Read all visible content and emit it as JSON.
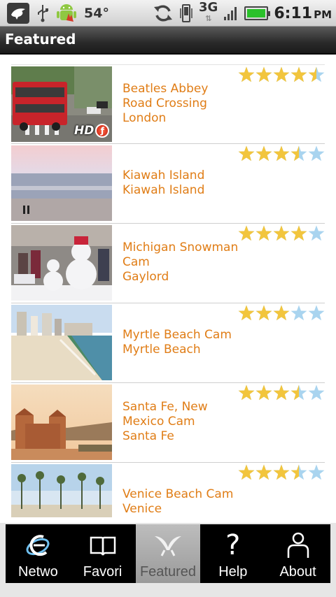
{
  "status_bar": {
    "temperature": "54°",
    "network": "3G",
    "time": "6:11",
    "ampm": "PM"
  },
  "header": {
    "title": "Featured"
  },
  "cams": [
    {
      "lines": [
        "Beatles Abbey",
        "Road Crossing",
        "London"
      ],
      "rating": 4.5,
      "hd_label": "HD"
    },
    {
      "lines": [
        "Kiawah Island",
        "Kiawah Island"
      ],
      "rating": 3.5
    },
    {
      "lines": [
        "Michigan Snowman",
        "Cam",
        "Gaylord"
      ],
      "rating": 4
    },
    {
      "lines": [
        "Myrtle Beach Cam",
        "Myrtle Beach"
      ],
      "rating": 3
    },
    {
      "lines": [
        "Santa Fe, New",
        "Mexico Cam",
        "Santa Fe"
      ],
      "rating": 3.5
    },
    {
      "lines": [
        "Venice Beach Cam",
        "Venice"
      ],
      "rating": 3.5
    }
  ],
  "tabs": [
    {
      "label": "Netwo",
      "icon": "network-icon"
    },
    {
      "label": "Favori",
      "icon": "book-icon"
    },
    {
      "label": "Featured",
      "icon": "featured-icon",
      "active": true
    },
    {
      "label": "Help",
      "icon": "question-icon"
    },
    {
      "label": "About",
      "icon": "person-icon"
    }
  ],
  "colors": {
    "accent": "#e07d16",
    "star_filled": "#f2c53d",
    "star_empty": "#a9d4ef"
  }
}
